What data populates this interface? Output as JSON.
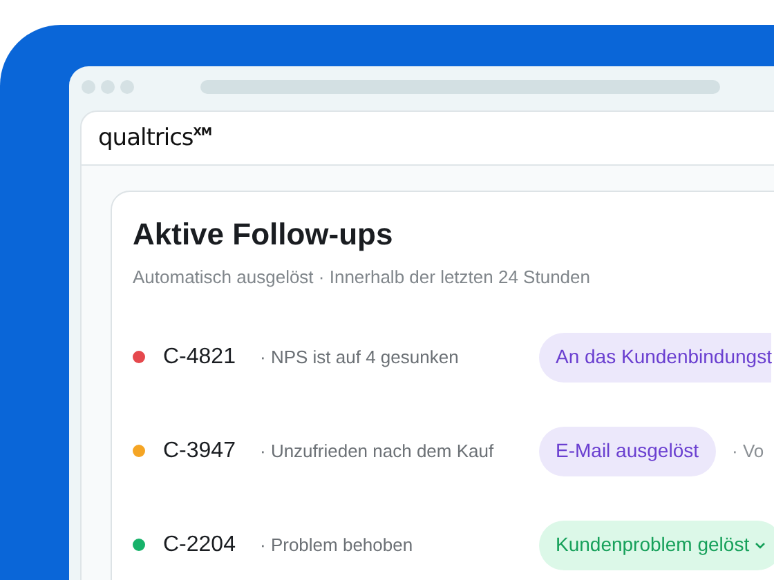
{
  "logo": "qualtrics$^{XM}$",
  "card": {
    "title": "Aktive Follow-ups",
    "subtitle": "Automatisch ausgelöst · Innerhalb der letzten 24 Stunden"
  },
  "followups": [
    {
      "id": "C-4821",
      "color": "#e5484d",
      "note": "· NPS ist auf 4 gesunken",
      "status": {
        "kind": "pending",
        "text": "An das Kundenbindungst"
      }
    },
    {
      "id": "C-3947",
      "color": "#f5a524",
      "note": "· Unzufrieden nach dem Kauf",
      "status": {
        "kind": "sent",
        "text": "E-Mail ausgelöst"
      },
      "extra": "· Vo"
    },
    {
      "id": "C-2204",
      "color": "#17b26a",
      "note": "· Problem behoben",
      "status": {
        "kind": "resolved",
        "text": "Kundenproblem gelöst"
      }
    }
  ]
}
